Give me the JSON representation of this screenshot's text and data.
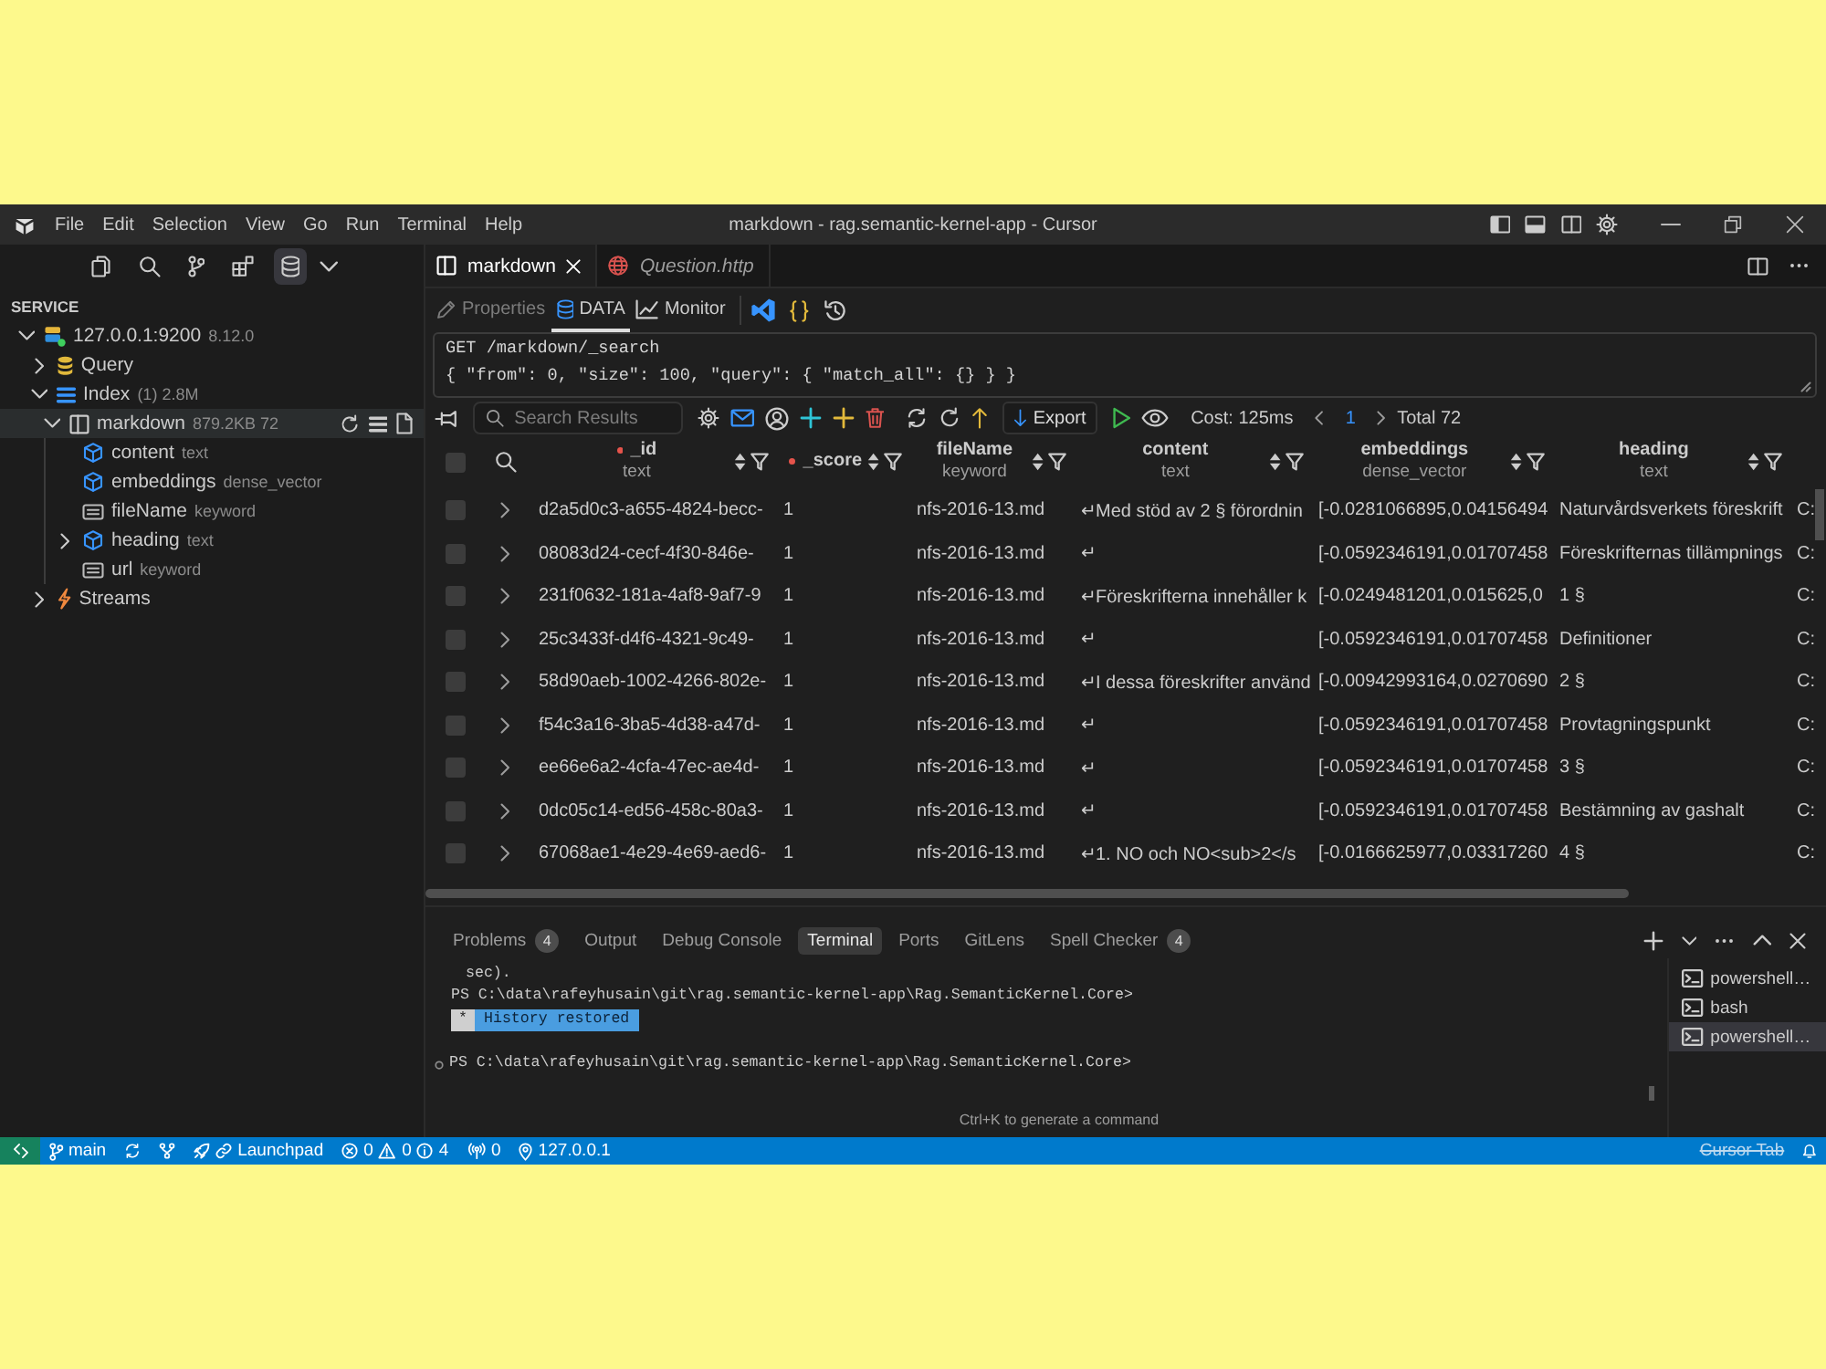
{
  "window": {
    "title": "markdown - rag.semantic-kernel-app - Cursor"
  },
  "menu": [
    "File",
    "Edit",
    "Selection",
    "View",
    "Go",
    "Run",
    "Terminal",
    "Help"
  ],
  "sidebar": {
    "activity": [
      {
        "kind": "explorer",
        "selected": false
      },
      {
        "kind": "search",
        "selected": false
      },
      {
        "kind": "source-control",
        "selected": false
      },
      {
        "kind": "extensions",
        "selected": false
      },
      {
        "kind": "database",
        "selected": true
      }
    ],
    "section": "SERVICE",
    "tree": [
      {
        "label": "127.0.0.1:9200",
        "detail": "8.12.0",
        "kind": "server",
        "expanded": true,
        "selected": false,
        "children": [
          {
            "label": "Query",
            "kind": "query",
            "expanded": false,
            "selected": false
          },
          {
            "label": "Index",
            "detail": "(1) 2.8M",
            "kind": "index",
            "expanded": true,
            "selected": false,
            "children": [
              {
                "label": "markdown",
                "detail": "879.2KB 72",
                "kind": "table",
                "expanded": true,
                "selected": true,
                "children": [
                  {
                    "label": "content",
                    "detail": "text",
                    "kind": "analyzed",
                    "expandable": false,
                    "selected": false
                  },
                  {
                    "label": "embeddings",
                    "detail": "dense_vector",
                    "kind": "analyzed",
                    "expandable": false,
                    "selected": false
                  },
                  {
                    "label": "fileName",
                    "detail": "keyword",
                    "kind": "keyword",
                    "expandable": false,
                    "selected": false
                  },
                  {
                    "label": "heading",
                    "detail": "text",
                    "kind": "analyzed",
                    "expandable": true,
                    "selected": false
                  },
                  {
                    "label": "url",
                    "detail": "keyword",
                    "kind": "keyword",
                    "expandable": false,
                    "selected": false
                  }
                ]
              }
            ]
          },
          {
            "label": "Streams",
            "kind": "streams",
            "expanded": false,
            "selected": false
          }
        ]
      }
    ]
  },
  "editor_tabs": [
    {
      "label": "markdown",
      "kind": "table",
      "selected": true,
      "preview": false
    },
    {
      "label": "Question.http",
      "kind": "http",
      "selected": false,
      "preview": true
    }
  ],
  "view_tabs": [
    {
      "label": "Properties",
      "kind": "properties",
      "selected": false,
      "disabled": true
    },
    {
      "label": "DATA",
      "kind": "data",
      "selected": true,
      "disabled": false
    },
    {
      "label": "Monitor",
      "kind": "monitor",
      "selected": false,
      "disabled": false
    }
  ],
  "query_editor": {
    "lines": [
      "GET /markdown/_search",
      "{ \"from\": 0, \"size\": 100, \"query\": { \"match_all\": {} } }"
    ]
  },
  "results_toolbar": {
    "search": {
      "placeholder": "Search Results"
    },
    "export": "Export",
    "cost": "Cost: 125ms",
    "page": "1",
    "total": "Total 72"
  },
  "table": {
    "select_all": false,
    "columns": [
      {
        "name": "_id",
        "type": "text",
        "marked": true
      },
      {
        "name": "_score",
        "marked": true
      },
      {
        "name": "fileName",
        "type": "keyword",
        "marked": false
      },
      {
        "name": "content",
        "type": "text",
        "marked": false
      },
      {
        "name": "embeddings",
        "type": "dense_vector",
        "marked": false
      },
      {
        "name": "heading",
        "type": "text",
        "marked": false
      }
    ],
    "rows": [
      {
        "checked": false,
        "expanded": false,
        "cells": [
          "d2a5d0c3-a655-4824-becc-",
          "1",
          "nfs-2016-13.md",
          "↵Med stöd av 2 § förordnin",
          "[-0.0281066895,0.04156494",
          "Naturvårdsverkets föreskrift",
          "C:"
        ]
      },
      {
        "checked": false,
        "expanded": false,
        "cells": [
          "08083d24-cecf-4f30-846e-",
          "1",
          "nfs-2016-13.md",
          "↵",
          "[-0.0592346191,0.01707458",
          "Föreskrifternas tillämpnings",
          "C:"
        ]
      },
      {
        "checked": false,
        "expanded": false,
        "cells": [
          "231f0632-181a-4af8-9af7-9",
          "1",
          "nfs-2016-13.md",
          "↵Föreskrifterna innehåller k",
          "[-0.0249481201,0.015625,0",
          "1 §",
          "C:"
        ]
      },
      {
        "checked": false,
        "expanded": false,
        "cells": [
          "25c3433f-d4f6-4321-9c49-",
          "1",
          "nfs-2016-13.md",
          "↵",
          "[-0.0592346191,0.01707458",
          "Definitioner",
          "C:"
        ]
      },
      {
        "checked": false,
        "expanded": false,
        "cells": [
          "58d90aeb-1002-4266-802e-",
          "1",
          "nfs-2016-13.md",
          "↵I dessa föreskrifter använd",
          "[-0.00942993164,0.0270690",
          "2 §",
          "C:"
        ]
      },
      {
        "checked": false,
        "expanded": false,
        "cells": [
          "f54c3a16-3ba5-4d38-a47d-",
          "1",
          "nfs-2016-13.md",
          "↵",
          "[-0.0592346191,0.01707458",
          "Provtagningspunkt",
          "C:"
        ]
      },
      {
        "checked": false,
        "expanded": false,
        "cells": [
          "ee66e6a2-4cfa-47ec-ae4d-",
          "1",
          "nfs-2016-13.md",
          "↵",
          "[-0.0592346191,0.01707458",
          "3 §",
          "C:"
        ]
      },
      {
        "checked": false,
        "expanded": false,
        "cells": [
          "0dc05c14-ed56-458c-80a3-",
          "1",
          "nfs-2016-13.md",
          "↵",
          "[-0.0592346191,0.01707458",
          "Bestämning av gashalt",
          "C:"
        ]
      },
      {
        "checked": false,
        "expanded": false,
        "cells": [
          "67068ae1-4e29-4e69-aed6-",
          "1",
          "nfs-2016-13.md",
          "↵1. NO och NO<sub>2</s",
          "[-0.0166625977,0.03317260",
          "4 §",
          "C:"
        ]
      }
    ]
  },
  "panel": {
    "tabs": [
      {
        "label": "Problems",
        "badge": "4",
        "selected": false
      },
      {
        "label": "Output",
        "selected": false
      },
      {
        "label": "Debug Console",
        "selected": false
      },
      {
        "label": "Terminal",
        "selected": true
      },
      {
        "label": "Ports",
        "selected": false
      },
      {
        "label": "GitLens",
        "selected": false
      },
      {
        "label": "Spell Checker",
        "badge": "4",
        "selected": false
      }
    ],
    "terminal": {
      "lines": [
        {
          "kind": "continuation",
          "text": "sec)."
        },
        {
          "kind": "output",
          "text": "PS C:\\data\\rafeyhusain\\git\\rag.semantic-kernel-app\\Rag.SemanticKernel.Core>"
        },
        {
          "kind": "notice",
          "marker": "*",
          "text": "History restored"
        },
        {
          "kind": "prompt",
          "text": "PS C:\\data\\rafeyhusain\\git\\rag.semantic-kernel-app\\Rag.SemanticKernel.Core>"
        }
      ],
      "hint": "Ctrl+K to generate a command"
    },
    "instances": [
      {
        "label": "powershell…",
        "selected": false
      },
      {
        "label": "bash",
        "selected": false
      },
      {
        "label": "powershell…",
        "selected": true
      }
    ]
  },
  "status_bar": {
    "branch": "main",
    "launchpad": "Launchpad",
    "errors": "0",
    "warnings": "0",
    "infos": "4",
    "ports": "0",
    "host": "127.0.0.1",
    "cursor_tab": {
      "label": "Cursor Tab",
      "disabled": true
    }
  }
}
